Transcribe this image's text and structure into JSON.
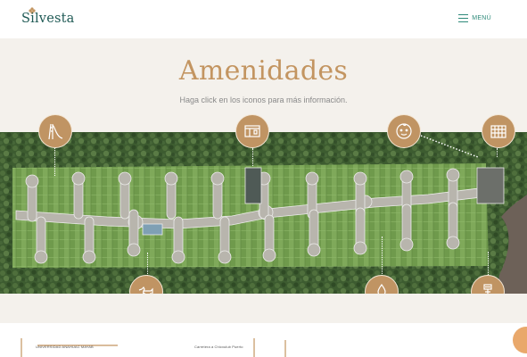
{
  "header": {
    "brand": "Silvesta",
    "menu_label": "MENÚ",
    "accent_color": "#2f8a7a"
  },
  "hero": {
    "title": "Amenidades",
    "subtitle": "Haga click en los iconos para más información.",
    "title_color": "#c39561"
  },
  "amenities": [
    {
      "icon": "slide-icon"
    },
    {
      "icon": "clubhouse-icon"
    },
    {
      "icon": "kids-face-icon"
    },
    {
      "icon": "building-icon"
    },
    {
      "icon": "dog-icon"
    },
    {
      "icon": "water-drop-icon"
    },
    {
      "icon": "shower-icon"
    }
  ],
  "map_labels": {
    "left": "UNIVERSIDAD ANÁHUAC MAYAB",
    "middle": "Carretera a Chicxulub Puerto"
  }
}
